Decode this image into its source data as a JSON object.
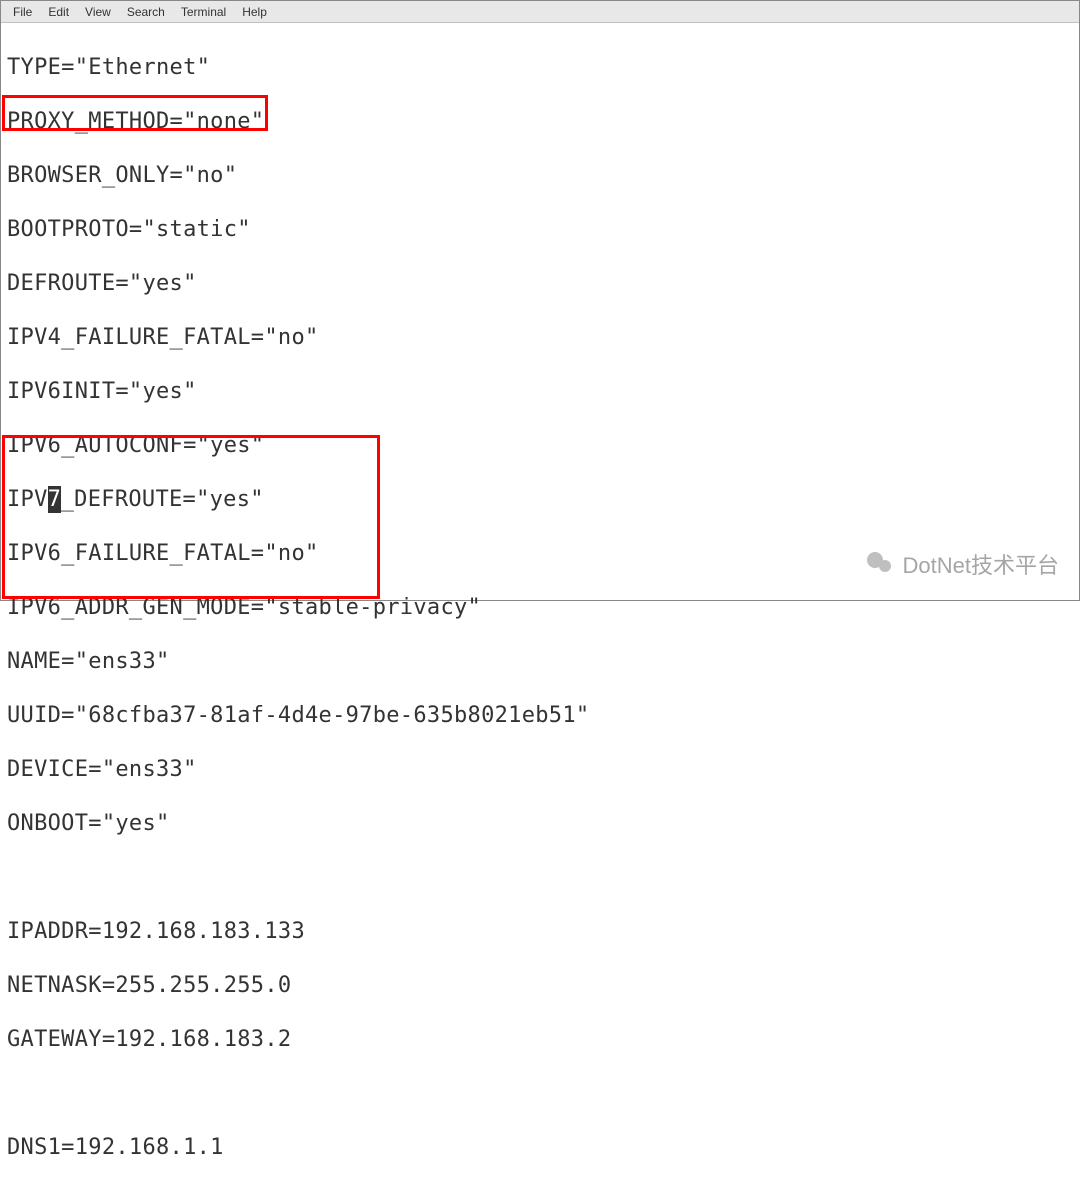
{
  "menu": {
    "file": "File",
    "edit": "Edit",
    "view": "View",
    "search": "Search",
    "terminal": "Terminal",
    "help": "Help"
  },
  "lines": {
    "l1": "TYPE=\"Ethernet\"",
    "l2": "PROXY_METHOD=\"none\"",
    "l3": "BROWSER_ONLY=\"no\"",
    "l4": "BOOTPROTO=\"static\"",
    "l5": "DEFROUTE=\"yes\"",
    "l6": "IPV4_FAILURE_FATAL=\"no\"",
    "l7": "IPV6INIT=\"yes\"",
    "l8": "IPV6_AUTOCONF=\"yes\"",
    "l9a": "IPV",
    "l9cursor": "7",
    "l9b": "_DEFROUTE=\"yes\"",
    "l10": "IPV6_FAILURE_FATAL=\"no\"",
    "l11": "IPV6_ADDR_GEN_MODE=\"stable-privacy\"",
    "l12": "NAME=\"ens33\"",
    "l13": "UUID=\"68cfba37-81af-4d4e-97be-635b8021eb51\"",
    "l14": "DEVICE=\"ens33\"",
    "l15": "ONBOOT=\"yes\"",
    "l16": "",
    "l17": "IPADDR=192.168.183.133",
    "l18": "NETNASK=255.255.255.0",
    "l19": "GATEWAY=192.168.183.2",
    "l20": "",
    "l21": "DNS1=192.168.1.1"
  },
  "watermark": "DotNet技术平台"
}
